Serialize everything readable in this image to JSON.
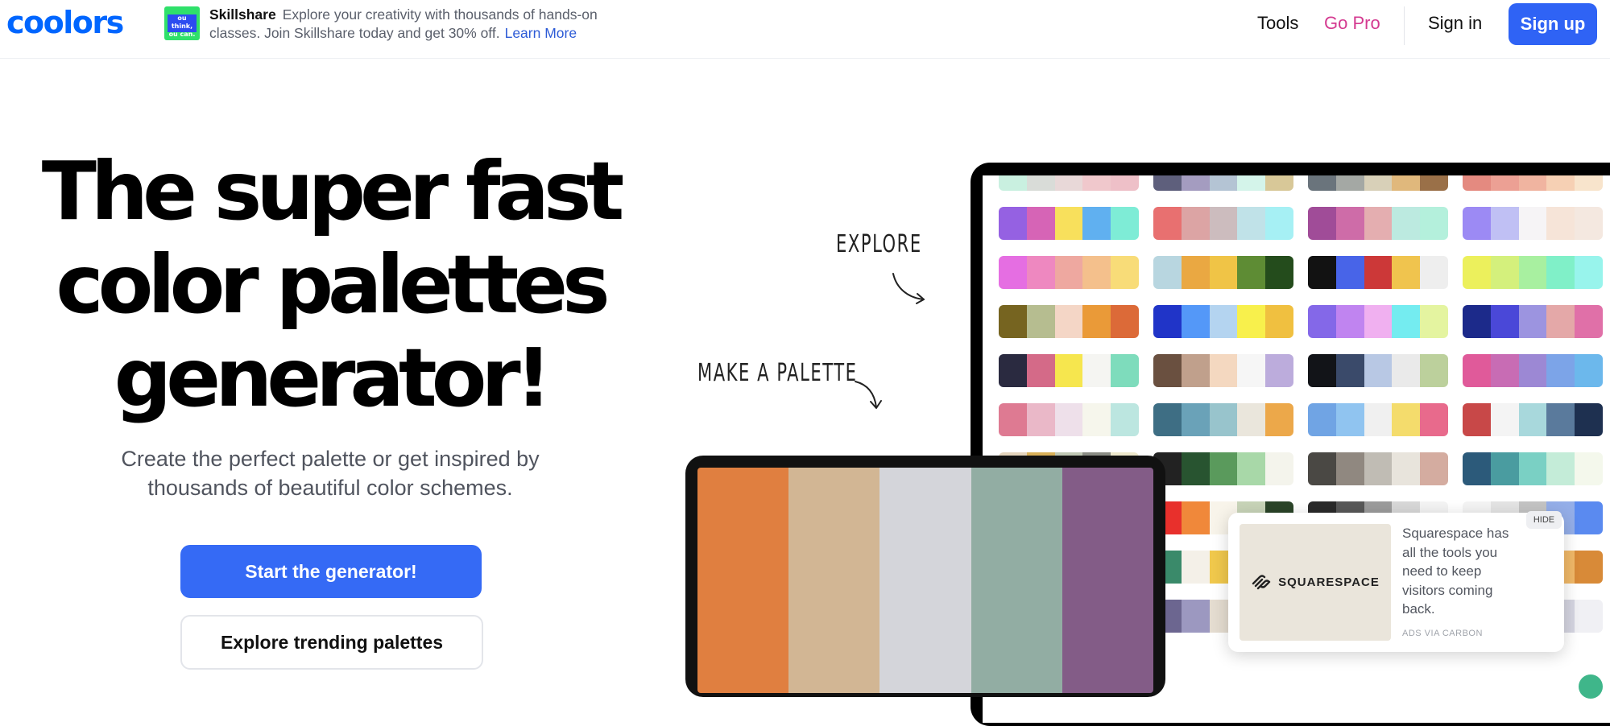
{
  "header": {
    "logo": "coolors",
    "ad": {
      "thumb_text": "ou think, ou can. ye",
      "brand": "Skillshare",
      "text": "Explore your creativity with thousands of hands-on classes. Join Skillshare today and get 30% off.",
      "link": "Learn More"
    },
    "nav": {
      "tools": "Tools",
      "go_pro": "Go Pro",
      "sign_in": "Sign in",
      "sign_up": "Sign up"
    }
  },
  "hero": {
    "title_line1": "The super fast",
    "title_line2": "color palettes",
    "title_line3": "generator!",
    "subtitle": "Create the perfect palette or get inspired by thousands of beautiful color schemes.",
    "start_button": "Start the generator!",
    "explore_button": "Explore trending palettes"
  },
  "illustration": {
    "label_explore": "EXPLORE",
    "label_make": "MAKE A PALETTE",
    "generator_colors": [
      "#e07f40",
      "#d2b694",
      "#d4d5da",
      "#92ada3",
      "#835c87"
    ],
    "grid_columns": [
      [
        [
          "#c9f0e0",
          "#d9dcd8",
          "#e8d8d8",
          "#f0c8cc",
          "#eec0c8"
        ],
        [
          "#9561e2",
          "#d664b6",
          "#f8e05c",
          "#60b0f0",
          "#7eecd6"
        ],
        [
          "#e56ee2",
          "#ee88c0",
          "#eea8a0",
          "#f4c08c",
          "#f8dc78"
        ],
        [
          "#766420",
          "#b6bd90",
          "#f4d6c6",
          "#ea9a38",
          "#dc6a38"
        ],
        [
          "#2a2a40",
          "#d46a88",
          "#f6e64e",
          "#f5f5f2",
          "#7edcbc"
        ],
        [
          "#de7a92",
          "#eab8c8",
          "#eee0ea",
          "#f6f6ec",
          "#bce6e0"
        ],
        [
          "#e4d4bc",
          "#d8b058",
          "#c0c8b4",
          "#8a8c84",
          "#eee8cc"
        ],
        [
          "#f0c44a",
          "#f49040",
          "#e46a68",
          "#d04a5c",
          "#7e3458"
        ],
        [
          "#e8eef0",
          "#c4d4ec",
          "#8cb2e8",
          "#4a7ee0",
          "#3846b4"
        ],
        [
          "#f5f0e6",
          "#e6c8a4",
          "#cc9e78",
          "#946848",
          "#5c3a26"
        ]
      ],
      [
        [
          "#5e5f7c",
          "#a49cc0",
          "#b4c4d4",
          "#d4f4ea",
          "#d8c898"
        ],
        [
          "#e87070",
          "#dca4a4",
          "#ccbcbe",
          "#c0e2e8",
          "#a6f0f4"
        ],
        [
          "#b8d6e0",
          "#eaa842",
          "#f0c446",
          "#5e8c34",
          "#244c1c"
        ],
        [
          "#2034c8",
          "#5498f8",
          "#b4d4f0",
          "#f8f04c",
          "#f0c040"
        ],
        [
          "#6a5040",
          "#c0a08c",
          "#f4d8c0",
          "#f6f6f6",
          "#bcacdc"
        ],
        [
          "#3e6e84",
          "#6aa2b8",
          "#98c4cc",
          "#eae6dc",
          "#eca84a"
        ],
        [
          "#222222",
          "#285430",
          "#5a9a5c",
          "#a8d8a8",
          "#f4f4ec"
        ],
        [
          "#e8302c",
          "#f0883a",
          "#f8f4ea",
          "#c8d4b8",
          "#2a4428"
        ],
        [
          "#3a8a6a",
          "#f4f0e8",
          "#f0c84c",
          "#8cc8a8",
          "#2a6a5c"
        ],
        [
          "#6c6690",
          "#9c98c0",
          "#e4dcd0",
          "#f0cca8",
          "#e89878"
        ]
      ],
      [
        [
          "#6a747c",
          "#a4a8a4",
          "#d8d0b8",
          "#e0b87c",
          "#9a7048"
        ],
        [
          "#a04c98",
          "#ce6ca8",
          "#e4aeb0",
          "#bceae0",
          "#b4f0dc"
        ],
        [
          "#121212",
          "#4864e8",
          "#cc3838",
          "#f0c44e",
          "#eeeeee"
        ],
        [
          "#8468e8",
          "#c084f0",
          "#f0b0f0",
          "#74ecf0",
          "#e4f4a0"
        ],
        [
          "#121418",
          "#3a4a6a",
          "#b8c8e4",
          "#eaeaea",
          "#bcd09c"
        ],
        [
          "#70a4e4",
          "#90c4f0",
          "#f0f0f0",
          "#f4dc6c",
          "#e86a8c"
        ],
        [
          "#4a4844",
          "#908880",
          "#c0bcb4",
          "#e8e4dc",
          "#d4aca0"
        ],
        [
          "#2a2a2a",
          "#585858",
          "#9c9c9c",
          "#d8d8d8",
          "#f4f4f4"
        ],
        [
          "#e4c0a8",
          "#c89c80",
          "#8c6c58",
          "#5a4638",
          "#2a2220"
        ],
        [
          "#f4f0f8",
          "#d8cce8",
          "#b4a0d4",
          "#8a70b8",
          "#5a3e8c"
        ]
      ],
      [
        [
          "#e48a80",
          "#eca094",
          "#f0b4a0",
          "#f6d0b4",
          "#f8e4cc"
        ],
        [
          "#9c8af4",
          "#c0c0f4",
          "#f6f4f6",
          "#f6e4d8",
          "#f4e8e0"
        ],
        [
          "#ecf05c",
          "#d4f07c",
          "#a8f0a0",
          "#80f0c8",
          "#98f4ec"
        ],
        [
          "#1c2a8a",
          "#4a48d8",
          "#9c94e0",
          "#e4a8a8",
          "#e070a8"
        ],
        [
          "#e05a9a",
          "#c86cb4",
          "#9c88d4",
          "#7ca4e8",
          "#6cb8ec"
        ],
        [
          "#c84848",
          "#f4f4f4",
          "#a8d8dc",
          "#5a7a9c",
          "#1e3050"
        ],
        [
          "#2c5a7a",
          "#4a9ca0",
          "#7ad0c4",
          "#c4ecd8",
          "#f4f8ec"
        ],
        [
          "#f4f4f4",
          "#e4e4e4",
          "#c4c4c4",
          "#94aee8",
          "#5a8af0"
        ],
        [
          "#e8a4a4",
          "#f0c4b4",
          "#f4e0c4",
          "#f0b868",
          "#d88a38"
        ],
        [
          "#3a3a5a",
          "#6a6a8c",
          "#a4a4bc",
          "#d4d4e0",
          "#f0f0f4"
        ]
      ]
    ]
  },
  "carbon_ad": {
    "logo_text": "SQUARESPACE",
    "text": "Squarespace has all the tools you need to keep visitors coming back.",
    "via": "ADS VIA CARBON",
    "hide": "HIDE"
  }
}
